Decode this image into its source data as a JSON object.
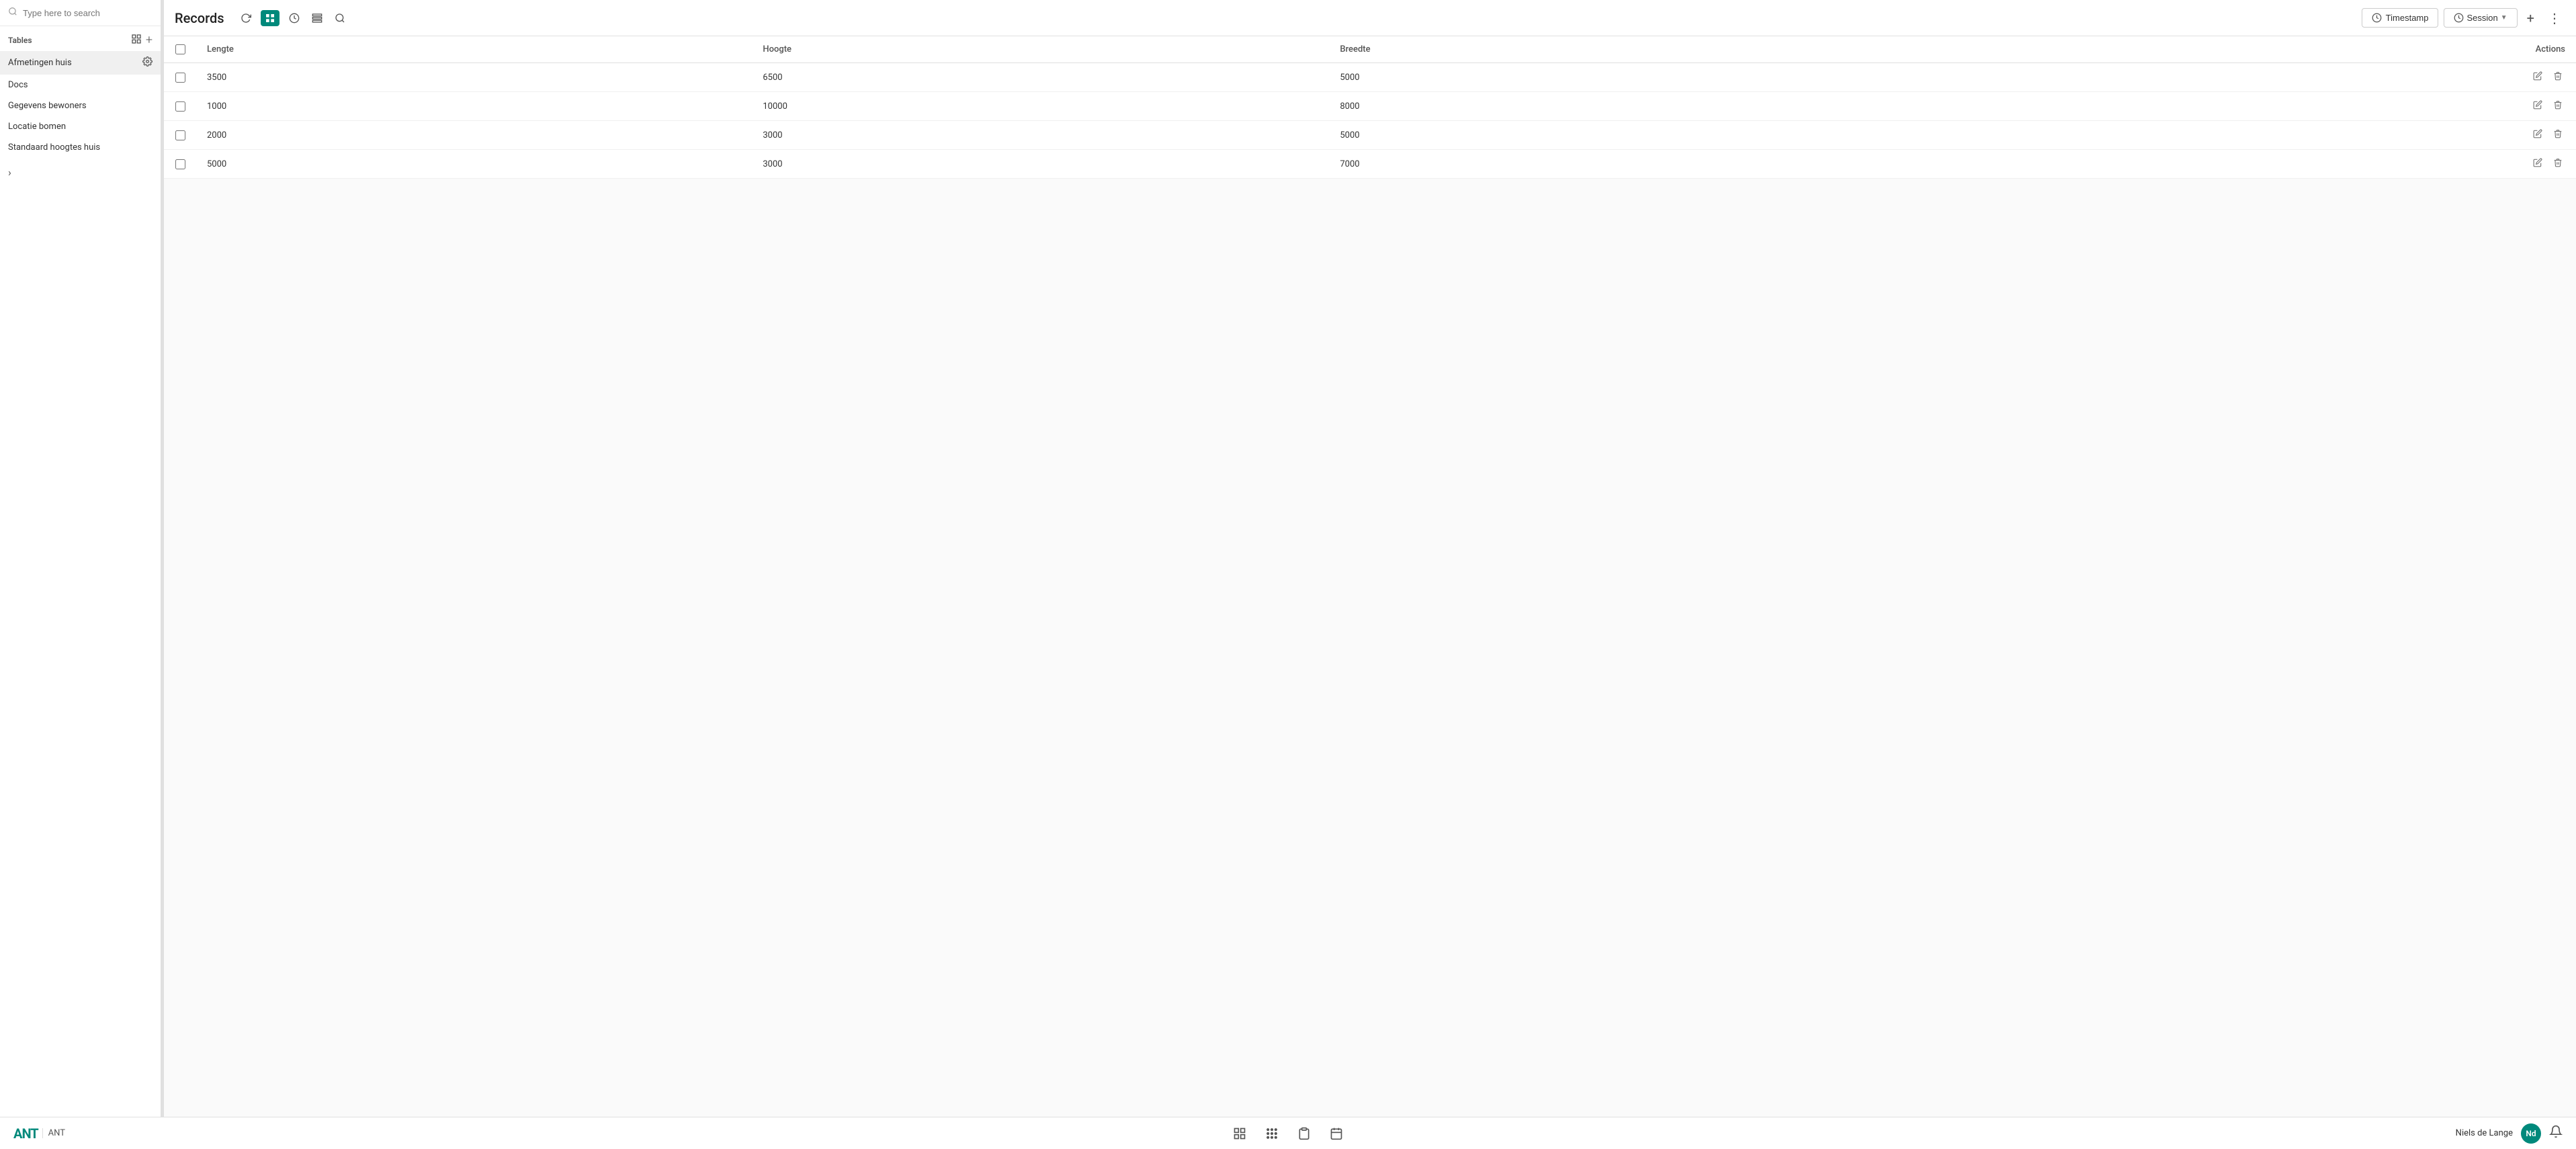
{
  "sidebar": {
    "search_placeholder": "Type here to search",
    "tables_label": "Tables",
    "items": [
      {
        "label": "Afmetingen huis",
        "active": true
      },
      {
        "label": "Docs",
        "active": false
      },
      {
        "label": "Gegevens bewoners",
        "active": false
      },
      {
        "label": "Locatie bomen",
        "active": false
      },
      {
        "label": "Standaard hoogtes huis",
        "active": false
      }
    ]
  },
  "toolbar": {
    "title": "Records",
    "timestamp_label": "Timestamp",
    "session_label": "Session"
  },
  "table": {
    "headers": [
      "",
      "Lengte",
      "Hoogte",
      "Breedte",
      "Actions"
    ],
    "rows": [
      {
        "lengte": "3500",
        "hoogte": "6500",
        "breedte": "5000"
      },
      {
        "lengte": "1000",
        "hoogte": "10000",
        "breedte": "8000"
      },
      {
        "lengte": "2000",
        "hoogte": "3000",
        "breedte": "5000"
      },
      {
        "lengte": "5000",
        "hoogte": "3000",
        "breedte": "7000"
      }
    ]
  },
  "bottom_bar": {
    "ant_label": "ANT",
    "user_name": "Niels de Lange",
    "user_initials": "Nd"
  }
}
